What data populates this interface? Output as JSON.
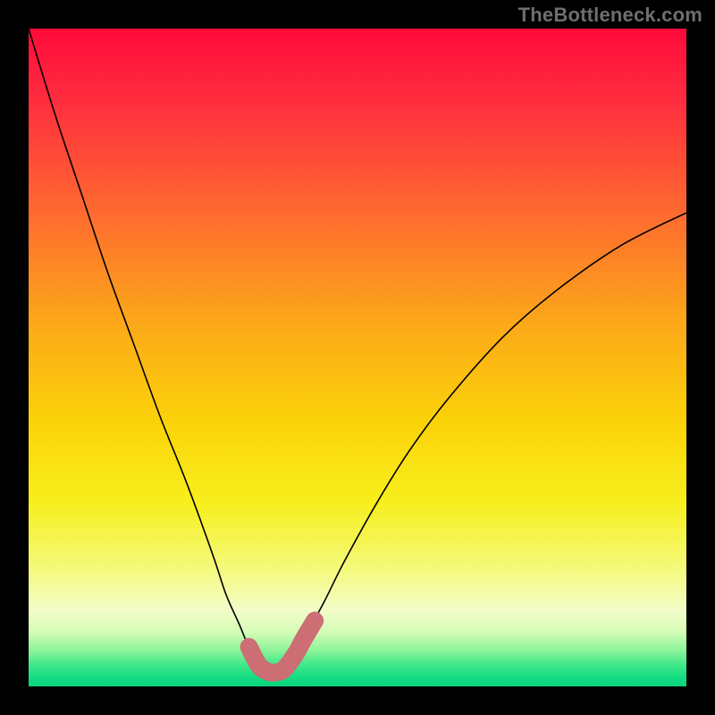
{
  "watermark": "TheBottleneck.com",
  "chart_data": {
    "type": "line",
    "title": "",
    "xlabel": "",
    "ylabel": "",
    "xlim": [
      0,
      100
    ],
    "ylim": [
      0,
      100
    ],
    "grid": false,
    "series": [
      {
        "name": "curve",
        "color": "#000000",
        "stroke_width": 1.6,
        "x": [
          0,
          4,
          8,
          12,
          16,
          20,
          24,
          28,
          30,
          32,
          33.5,
          35.5,
          37.5,
          39,
          40,
          42,
          45,
          48,
          53,
          58,
          64,
          72,
          80,
          90,
          100
        ],
        "y": [
          100,
          87,
          75,
          63,
          52,
          41,
          31,
          20,
          14,
          9.5,
          6,
          3,
          2.2,
          2.8,
          4,
          7.5,
          13,
          19,
          28,
          36,
          44,
          53,
          60,
          67,
          72
        ]
      },
      {
        "name": "highlight",
        "color": "#cc6e73",
        "stroke_width": 20,
        "linecap": "round",
        "x": [
          33.5,
          35.0,
          36.5,
          38.0,
          39.0,
          40.5,
          42.0,
          43.5
        ],
        "y": [
          6.0,
          3.2,
          2.2,
          2.2,
          2.8,
          4.8,
          7.5,
          10.0
        ]
      }
    ],
    "background_gradient": {
      "stops": [
        {
          "offset": 0.0,
          "color": "#ff0a3a"
        },
        {
          "offset": 0.1,
          "color": "#ff2a3f"
        },
        {
          "offset": 0.28,
          "color": "#fe6a2f"
        },
        {
          "offset": 0.45,
          "color": "#fca919"
        },
        {
          "offset": 0.6,
          "color": "#fbd309"
        },
        {
          "offset": 0.72,
          "color": "#f7ef1c"
        },
        {
          "offset": 0.82,
          "color": "#f4f97a"
        },
        {
          "offset": 0.885,
          "color": "#f3fcc9"
        },
        {
          "offset": 0.918,
          "color": "#d3fcb6"
        },
        {
          "offset": 0.945,
          "color": "#8df49a"
        },
        {
          "offset": 0.965,
          "color": "#47e98b"
        },
        {
          "offset": 0.985,
          "color": "#17dd82"
        },
        {
          "offset": 1.0,
          "color": "#06d47d"
        }
      ]
    }
  }
}
